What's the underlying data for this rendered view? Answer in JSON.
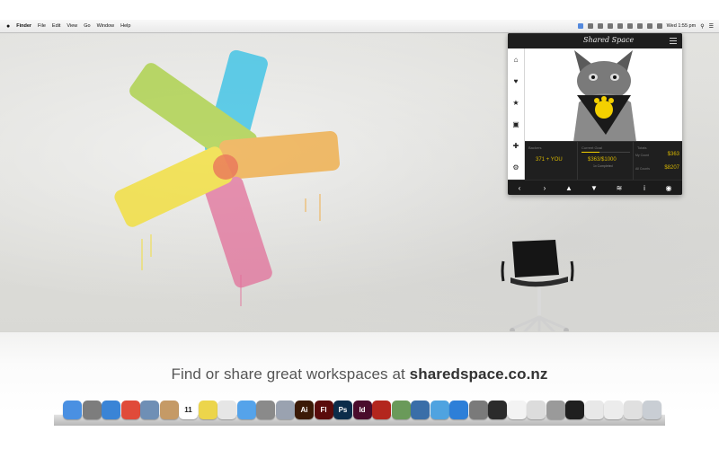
{
  "menubar": {
    "apple": "",
    "items": [
      "Finder",
      "File",
      "Edit",
      "View",
      "Go",
      "Window",
      "Help"
    ],
    "clock": "Wed 1:55 pm"
  },
  "widget": {
    "logo": "Shared Space",
    "nav_icons": [
      "home-icon",
      "heart-icon",
      "star-icon",
      "image-icon",
      "add-user-icon",
      "gear-icon"
    ],
    "stats": {
      "backers_label": "Backers",
      "backers_value": "371 + YOU",
      "current_goal_label": "Current Goal",
      "current_goal_value": "$363/$1000",
      "goal_subtext": "1x Completed",
      "totals_label": "Totals",
      "my_count_label": "My Count",
      "my_count_value": "$363",
      "all_counts_label": "All Counts",
      "all_counts_value": "$8207",
      "goal_progress": 0.363
    },
    "toolbar_icons": [
      "previous-icon",
      "next-icon",
      "thumbs-up-icon",
      "thumbs-down-icon",
      "share-icon",
      "info-icon",
      "globe-icon"
    ]
  },
  "caption": {
    "prefix": "Find or share great workspaces at ",
    "site": "sharedspace.co.nz"
  },
  "dock": {
    "apps": [
      {
        "name": "Finder",
        "label": "",
        "color": "#4a90e2"
      },
      {
        "name": "Launchpad",
        "label": "",
        "color": "#7d7d7d"
      },
      {
        "name": "Safari",
        "label": "",
        "color": "#3a84d6"
      },
      {
        "name": "Chrome",
        "label": "",
        "color": "#e04b3a"
      },
      {
        "name": "Preview",
        "label": "",
        "color": "#6f8fb5"
      },
      {
        "name": "Contacts",
        "label": "",
        "color": "#c59a66"
      },
      {
        "name": "iCal",
        "label": "11",
        "color": "#ffffff"
      },
      {
        "name": "Stickies",
        "label": "",
        "color": "#ecd54b"
      },
      {
        "name": "Pages",
        "label": "",
        "color": "#e6e6e6"
      },
      {
        "name": "Messages",
        "label": "",
        "color": "#55a3ea"
      },
      {
        "name": "FaceTime",
        "label": "",
        "color": "#8a8a8a"
      },
      {
        "name": "Script Editor",
        "label": "",
        "color": "#9aa2b0"
      },
      {
        "name": "Illustrator",
        "label": "Ai",
        "color": "#3b1a07"
      },
      {
        "name": "Flash",
        "label": "Fl",
        "color": "#5a0c0c"
      },
      {
        "name": "Photoshop",
        "label": "Ps",
        "color": "#0c2c4a"
      },
      {
        "name": "InDesign",
        "label": "Id",
        "color": "#4a0c2c"
      },
      {
        "name": "Acrobat",
        "label": "",
        "color": "#b3261e"
      },
      {
        "name": "iPhoto",
        "label": "",
        "color": "#6a9a5a"
      },
      {
        "name": "Network",
        "label": "",
        "color": "#3a6ea8"
      },
      {
        "name": "iTunes",
        "label": "",
        "color": "#4fa3e0"
      },
      {
        "name": "App Store",
        "label": "",
        "color": "#2d7fd8"
      },
      {
        "name": "System Preferences",
        "label": "",
        "color": "#7a7a7a"
      },
      {
        "name": "Spotify",
        "label": "",
        "color": "#2b2b2b"
      },
      {
        "name": "Document",
        "label": "",
        "color": "#f3f3f3"
      },
      {
        "name": "Screenshot",
        "label": "",
        "color": "#dcdcdc"
      },
      {
        "name": "Camera",
        "label": "",
        "color": "#9a9a9a"
      },
      {
        "name": "Terminal",
        "label": "",
        "color": "#1f1f1f"
      },
      {
        "name": "Folder",
        "label": "",
        "color": "#e8e8e8"
      },
      {
        "name": "Downloads",
        "label": "",
        "color": "#ececec"
      },
      {
        "name": "Finder Window",
        "label": "",
        "color": "#e0e0e0"
      },
      {
        "name": "Trash",
        "label": "",
        "color": "#c9ced4"
      }
    ]
  },
  "colors": {
    "accent_yellow": "#f4d000",
    "widget_bg": "#1b1b1b",
    "gold": "#d7b600"
  }
}
